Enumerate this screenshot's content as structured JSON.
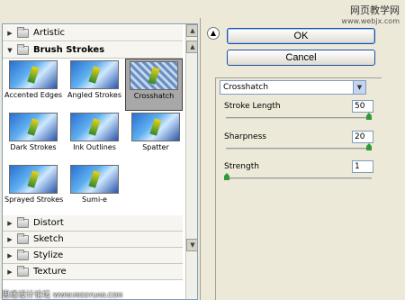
{
  "watermark": {
    "top_title": "网页教学网",
    "top_site": "www.webjx.com",
    "bottom_a": "思缘设计论坛",
    "bottom_b": "WWW.MISSYUAN.COM"
  },
  "categories": [
    {
      "label": "Artistic",
      "expanded": false
    },
    {
      "label": "Brush Strokes",
      "expanded": true
    },
    {
      "label": "Distort",
      "expanded": false
    },
    {
      "label": "Sketch",
      "expanded": false
    },
    {
      "label": "Stylize",
      "expanded": false
    },
    {
      "label": "Texture",
      "expanded": false
    }
  ],
  "brush_strokes_filters": [
    {
      "label": "Accented Edges",
      "selected": false
    },
    {
      "label": "Angled Strokes",
      "selected": false
    },
    {
      "label": "Crosshatch",
      "selected": true
    },
    {
      "label": "Dark Strokes",
      "selected": false
    },
    {
      "label": "Ink Outlines",
      "selected": false
    },
    {
      "label": "Spatter",
      "selected": false
    },
    {
      "label": "Sprayed Strokes",
      "selected": false
    },
    {
      "label": "Sumi-e",
      "selected": false
    }
  ],
  "buttons": {
    "ok": "OK",
    "cancel": "Cancel"
  },
  "selected_filter": "Crosshatch",
  "params": [
    {
      "label": "Stroke Length",
      "value": "50",
      "max": 50
    },
    {
      "label": "Sharpness",
      "value": "20",
      "max": 20
    },
    {
      "label": "Strength",
      "value": "1",
      "max": 3
    }
  ],
  "icons": {
    "collapse": "double-chevron-up-icon",
    "dropdown": "chevron-down-icon",
    "folder": "folder-icon"
  }
}
